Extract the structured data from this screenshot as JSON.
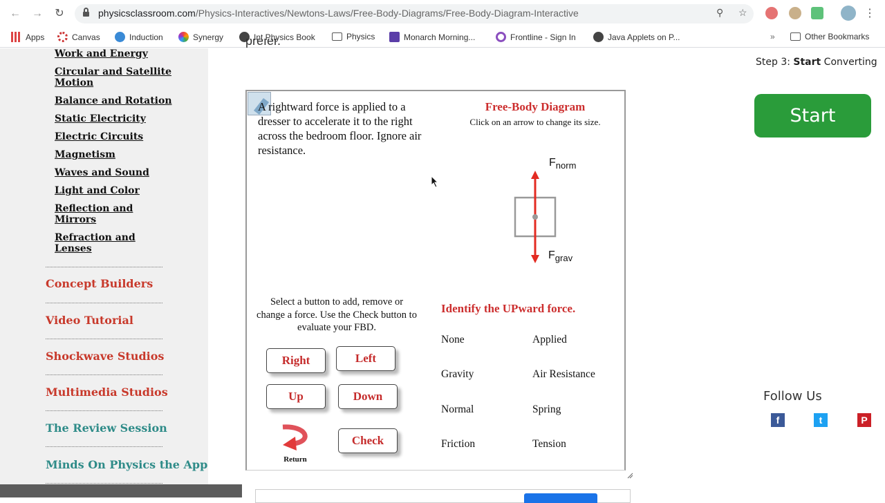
{
  "browser": {
    "url_host": "physicsclassroom.com",
    "url_path": "/Physics-Interactives/Newtons-Laws/Free-Body-Diagrams/Free-Body-Diagram-Interactive",
    "bookmarks": [
      {
        "label": "Apps",
        "icon": "apps-grid-icon"
      },
      {
        "label": "Canvas",
        "icon": "canvas-icon"
      },
      {
        "label": "Induction",
        "icon": "induction-icon"
      },
      {
        "label": "Synergy",
        "icon": "synergy-icon"
      },
      {
        "label": "Int Physics Book",
        "icon": "globe-icon"
      },
      {
        "label": "Physics",
        "icon": "folder-icon"
      },
      {
        "label": "Monarch Morning...",
        "icon": "list-icon"
      },
      {
        "label": "Frontline - Sign In",
        "icon": "frontline-icon"
      },
      {
        "label": "Java Applets on P...",
        "icon": "globe-icon"
      }
    ],
    "overflow_label": "»",
    "other_bookmarks": "Other Bookmarks"
  },
  "sidebar": {
    "topics": [
      "Work and Energy",
      "Circular and Satellite Motion",
      "Balance and Rotation",
      "Static Electricity",
      "Electric Circuits",
      "Magnetism",
      "Waves and Sound",
      "Light and Color",
      "Reflection and Mirrors",
      "Refraction and Lenses"
    ],
    "sections": [
      {
        "label": "Concept Builders",
        "color": "#c8392b"
      },
      {
        "label": "Video Tutorial",
        "color": "#c8392b"
      },
      {
        "label": "Shockwave Studios",
        "color": "#c8392b"
      },
      {
        "label": "Multimedia Studios",
        "color": "#c8392b"
      },
      {
        "label": "The Review Session",
        "color": "#2e8b88"
      },
      {
        "label": "Minds On Physics the App",
        "color": "#2e8b88"
      }
    ]
  },
  "content": {
    "cut_text": "prefer."
  },
  "applet": {
    "prompt": "A rightward force is applied to a dresser to accelerate it to the right across the bedroom floor. Ignore air resistance.",
    "fbd_title": "Free-Body Diagram",
    "fbd_subtitle": "Click on an arrow to change its size.",
    "forces": {
      "up_label_main": "F",
      "up_label_sub": "norm",
      "down_label_main": "F",
      "down_label_sub": "grav"
    },
    "instructions": "Select a button to add, remove or change a force. Use the Check button to evaluate your FBD.",
    "buttons": {
      "right": "Right",
      "left": "Left",
      "up": "Up",
      "down": "Down",
      "check": "Check",
      "return": "Return"
    },
    "identify": "Identify the UPward force.",
    "options": [
      "None",
      "Applied",
      "Gravity",
      "Air Resistance",
      "Normal",
      "Spring",
      "Friction",
      "Tension"
    ],
    "accent_color": "#cc2e2e"
  },
  "right_rail": {
    "step3_prefix": "Step 3: ",
    "step3_bold": "Start",
    "step3_suffix": " Converting",
    "start_label": "Start",
    "follow_us": "Follow Us",
    "social": [
      {
        "name": "facebook",
        "glyph": "f",
        "color": "#3b5998"
      },
      {
        "name": "twitter",
        "glyph": "t",
        "color": "#1da1f2"
      },
      {
        "name": "pinterest",
        "glyph": "P",
        "color": "#cb2027"
      }
    ]
  }
}
